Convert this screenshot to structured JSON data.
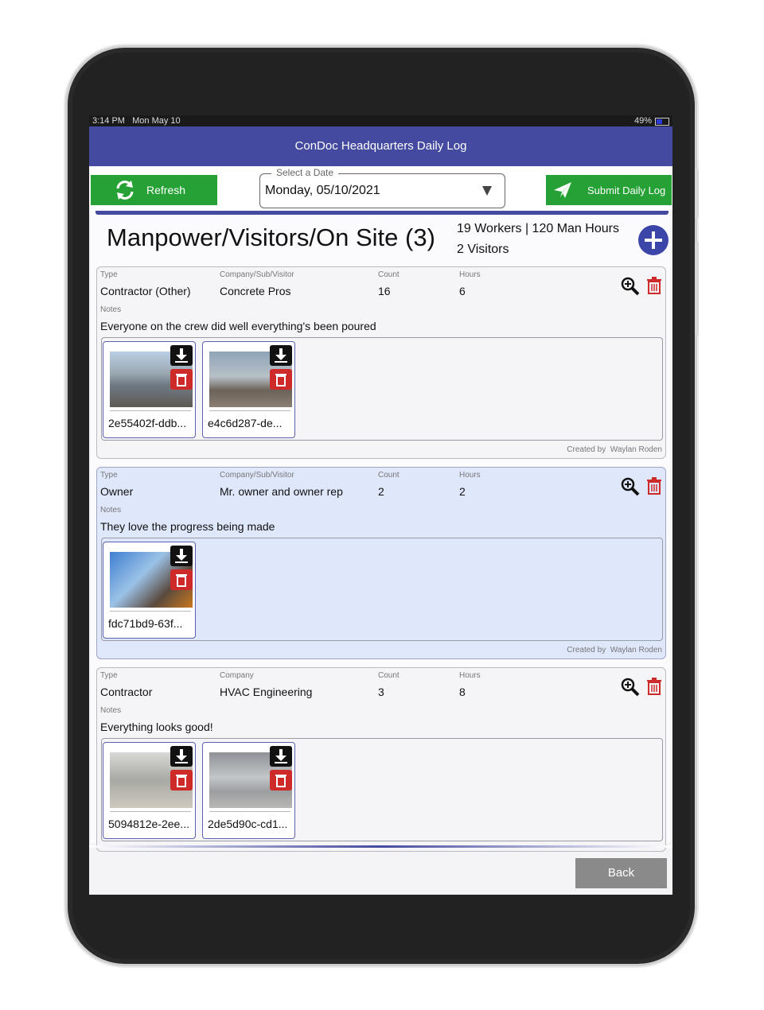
{
  "status": {
    "time": "3:14 PM",
    "date": "Mon May 10",
    "battery": "49%"
  },
  "title": "ConDoc Headquarters Daily Log",
  "toolbar": {
    "refresh_label": "Refresh",
    "date_legend": "Select a Date",
    "date_value": "Monday, 05/10/2021",
    "submit_label": "Submit Daily Log"
  },
  "section": {
    "title": "Manpower/Visitors/On Site (3)",
    "summary_workers": "19 Workers | 120 Man Hours",
    "summary_visitors": "2 Visitors"
  },
  "entries": [
    {
      "type_label": "Type",
      "type": "Contractor (Other)",
      "company_label": "Company/Sub/Visitor",
      "company": "Concrete Pros",
      "count_label": "Count",
      "count": "16",
      "hours_label": "Hours",
      "hours": "6",
      "notes_label": "Notes",
      "notes": "Everyone on the crew did well everything's been poured",
      "photos": [
        "2e55402f-ddb...",
        "e4c6d287-de..."
      ],
      "created_label": "Created by",
      "created_by": "Waylan Roden"
    },
    {
      "type_label": "Type",
      "type": "Owner",
      "company_label": "Company/Sub/Visitor",
      "company": "Mr. owner and owner rep",
      "count_label": "Count",
      "count": "2",
      "hours_label": "Hours",
      "hours": "2",
      "notes_label": "Notes",
      "notes": "They love the progress being made",
      "photos": [
        "fdc71bd9-63f..."
      ],
      "created_label": "Created by",
      "created_by": "Waylan Roden"
    },
    {
      "type_label": "Type",
      "type": "Contractor",
      "company_label": "Company",
      "company": "HVAC Engineering",
      "count_label": "Count",
      "count": "3",
      "hours_label": "Hours",
      "hours": "8",
      "notes_label": "Notes",
      "notes": "Everything looks good!",
      "photos": [
        "5094812e-2ee...",
        "2de5d90c-cd1..."
      ]
    }
  ],
  "back_label": "Back",
  "icons": {
    "refresh": "refresh-icon",
    "submit": "send-icon",
    "add": "plus-circle-icon",
    "zoom": "zoom-in-icon",
    "trash": "trash-icon",
    "download": "download-icon",
    "dropdown": "dropdown-arrow-icon"
  },
  "colors": {
    "header": "#434a9f",
    "button_green": "#26a135",
    "delete_red": "#cf2a2a",
    "highlight_row": "#dfe7fb",
    "back_gray": "#8a8a8a"
  }
}
